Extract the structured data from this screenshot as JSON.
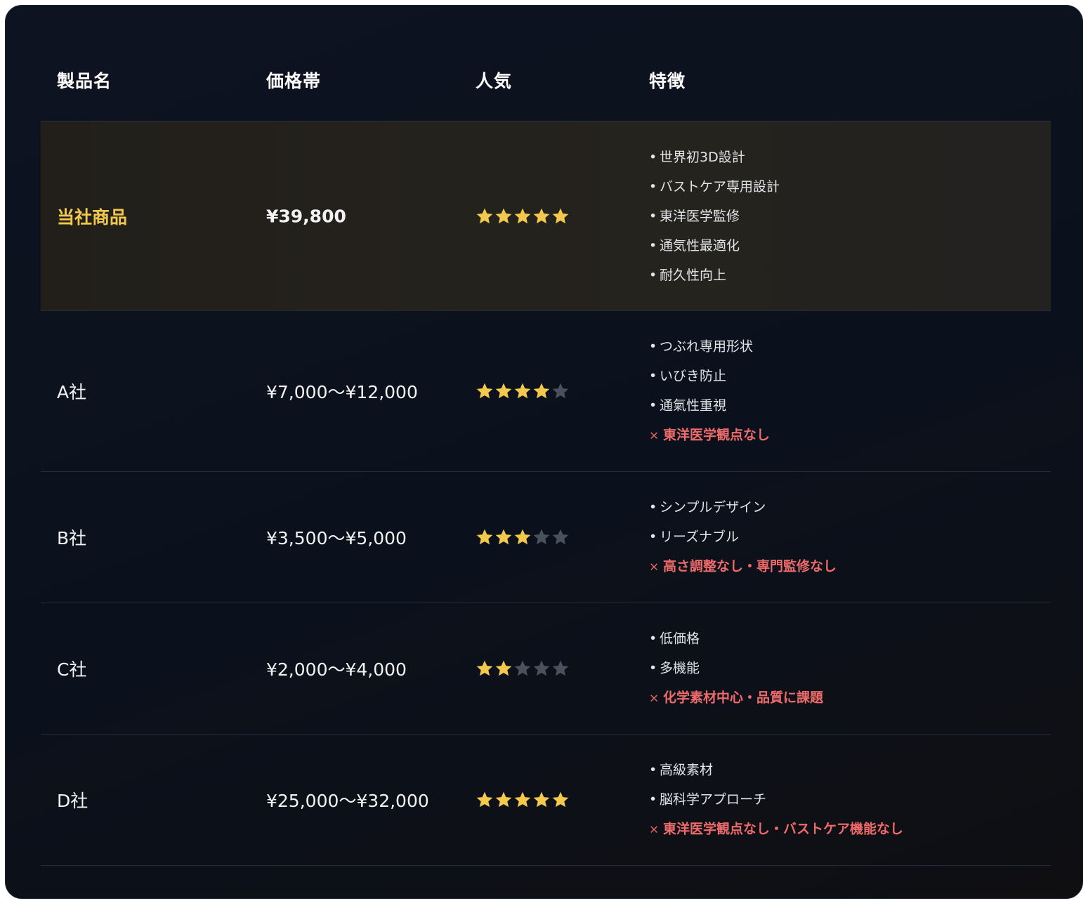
{
  "header": {
    "col_name": "製品名",
    "col_price": "価格帯",
    "col_popularity": "人気",
    "col_features": "特徴"
  },
  "colors": {
    "star_filled": "#f2c94c",
    "star_empty": "#4a505c",
    "highlight_name": "#f2c94c",
    "negative": "#ef6b6b"
  },
  "rows": [
    {
      "name": "当社商品",
      "price": "¥39,800",
      "rating": 5,
      "featured": true,
      "features": [
        {
          "bullet": "•",
          "text": "世界初3D設計",
          "negative": false
        },
        {
          "bullet": "•",
          "text": "バストケア専用設計",
          "negative": false
        },
        {
          "bullet": "•",
          "text": "東洋医学監修",
          "negative": false
        },
        {
          "bullet": "•",
          "text": "通気性最適化",
          "negative": false
        },
        {
          "bullet": "•",
          "text": "耐久性向上",
          "negative": false
        }
      ]
    },
    {
      "name": "A社",
      "price": "¥7,000〜¥12,000",
      "rating": 4,
      "featured": false,
      "features": [
        {
          "bullet": "•",
          "text": "つぶれ専用形状",
          "negative": false
        },
        {
          "bullet": "•",
          "text": "いびき防止",
          "negative": false
        },
        {
          "bullet": "•",
          "text": "通氣性重視",
          "negative": false
        },
        {
          "bullet": "×",
          "text": "東洋医学観点なし",
          "negative": true
        }
      ]
    },
    {
      "name": "B社",
      "price": "¥3,500〜¥5,000",
      "rating": 3,
      "featured": false,
      "features": [
        {
          "bullet": "•",
          "text": "シンプルデザイン",
          "negative": false
        },
        {
          "bullet": "•",
          "text": "リーズナブル",
          "negative": false
        },
        {
          "bullet": "×",
          "text": "高さ調整なし・専門監修なし",
          "negative": true
        }
      ]
    },
    {
      "name": "C社",
      "price": "¥2,000〜¥4,000",
      "rating": 2,
      "featured": false,
      "features": [
        {
          "bullet": "•",
          "text": "低価格",
          "negative": false
        },
        {
          "bullet": "•",
          "text": "多機能",
          "negative": false
        },
        {
          "bullet": "×",
          "text": "化学素材中心・品質に課題",
          "negative": true
        }
      ]
    },
    {
      "name": "D社",
      "price": "¥25,000〜¥32,000",
      "rating": 5,
      "featured": false,
      "features": [
        {
          "bullet": "•",
          "text": "高級素材",
          "negative": false
        },
        {
          "bullet": "•",
          "text": "脳科学アプローチ",
          "negative": false
        },
        {
          "bullet": "×",
          "text": "東洋医学観点なし・バストケア機能なし",
          "negative": true
        }
      ]
    }
  ]
}
